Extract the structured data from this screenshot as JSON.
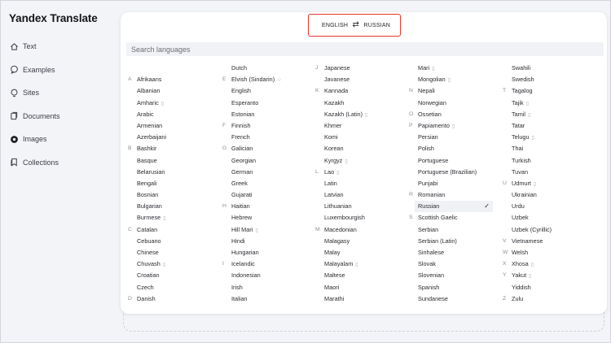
{
  "app": {
    "title": "Yandex Translate"
  },
  "nav": [
    {
      "label": "Text",
      "icon": "home-icon"
    },
    {
      "label": "Examples",
      "icon": "speech-bubble-icon"
    },
    {
      "label": "Sites",
      "icon": "lightbulb-icon"
    },
    {
      "label": "Documents",
      "icon": "document-icon"
    },
    {
      "label": "Images",
      "icon": "camera-icon"
    },
    {
      "label": "Collections",
      "icon": "bookmark-icon"
    }
  ],
  "switcher": {
    "source": "ENGLISH",
    "target": "RUSSIAN",
    "swap_icon": "swap-arrows-icon"
  },
  "search": {
    "placeholder": "Search languages"
  },
  "columns": [
    [
      {
        "name": ""
      },
      {
        "name": "Afrikaans",
        "letter": "A"
      },
      {
        "name": "Albanian"
      },
      {
        "name": "Amharic",
        "beta": true
      },
      {
        "name": "Arabic"
      },
      {
        "name": "Armenian"
      },
      {
        "name": "Azerbaijani"
      },
      {
        "name": "Bashkir",
        "letter": "B"
      },
      {
        "name": "Basque"
      },
      {
        "name": "Belarusian"
      },
      {
        "name": "Bengali"
      },
      {
        "name": "Bosnian"
      },
      {
        "name": "Bulgarian"
      },
      {
        "name": "Burmese",
        "beta": true
      },
      {
        "name": "Catalan",
        "letter": "C"
      },
      {
        "name": "Cebuano"
      },
      {
        "name": "Chinese"
      },
      {
        "name": "Chuvash",
        "beta": true
      },
      {
        "name": "Croatian"
      },
      {
        "name": "Czech"
      },
      {
        "name": "Danish",
        "letter": "D"
      }
    ],
    [
      {
        "name": "Dutch"
      },
      {
        "name": "Elvish (Sindarin)",
        "letter": "E",
        "beta": true,
        "beta_mark": "☆"
      },
      {
        "name": "English"
      },
      {
        "name": "Esperanto"
      },
      {
        "name": "Estonian"
      },
      {
        "name": "Finnish",
        "letter": "F"
      },
      {
        "name": "French"
      },
      {
        "name": "Galician",
        "letter": "G"
      },
      {
        "name": "Georgian"
      },
      {
        "name": "German"
      },
      {
        "name": "Greek"
      },
      {
        "name": "Gujarati"
      },
      {
        "name": "Haitian",
        "letter": "H"
      },
      {
        "name": "Hebrew"
      },
      {
        "name": "Hill Mari",
        "beta": true
      },
      {
        "name": "Hindi"
      },
      {
        "name": "Hungarian"
      },
      {
        "name": "Icelandic",
        "letter": "I"
      },
      {
        "name": "Indonesian"
      },
      {
        "name": "Irish"
      },
      {
        "name": "Italian"
      }
    ],
    [
      {
        "name": "Japanese",
        "letter": "J"
      },
      {
        "name": "Javanese"
      },
      {
        "name": "Kannada",
        "letter": "K"
      },
      {
        "name": "Kazakh"
      },
      {
        "name": "Kazakh (Latin)",
        "beta": true
      },
      {
        "name": "Khmer"
      },
      {
        "name": "Komi"
      },
      {
        "name": "Korean"
      },
      {
        "name": "Kyrgyz",
        "beta": true
      },
      {
        "name": "Lao",
        "letter": "L",
        "beta": true
      },
      {
        "name": "Latin"
      },
      {
        "name": "Latvian"
      },
      {
        "name": "Lithuanian"
      },
      {
        "name": "Luxembourgish"
      },
      {
        "name": "Macedonian",
        "letter": "M"
      },
      {
        "name": "Malagasy"
      },
      {
        "name": "Malay"
      },
      {
        "name": "Malayalam",
        "beta": true
      },
      {
        "name": "Maltese"
      },
      {
        "name": "Maori"
      },
      {
        "name": "Marathi"
      }
    ],
    [
      {
        "name": "Mari",
        "beta": true
      },
      {
        "name": "Mongolian",
        "beta": true
      },
      {
        "name": "Nepali",
        "letter": "N"
      },
      {
        "name": "Norwegian"
      },
      {
        "name": "Ossetian",
        "letter": "O"
      },
      {
        "name": "Papiamento",
        "letter": "P",
        "beta": true
      },
      {
        "name": "Persian"
      },
      {
        "name": "Polish"
      },
      {
        "name": "Portuguese"
      },
      {
        "name": "Portuguese (Brazilian)"
      },
      {
        "name": "Punjabi"
      },
      {
        "name": "Romanian",
        "letter": "R"
      },
      {
        "name": "Russian",
        "selected": true
      },
      {
        "name": "Scottish Gaelic",
        "letter": "S"
      },
      {
        "name": "Serbian"
      },
      {
        "name": "Serbian (Latin)"
      },
      {
        "name": "Sinhalese"
      },
      {
        "name": "Slovak"
      },
      {
        "name": "Slovenian"
      },
      {
        "name": "Spanish"
      },
      {
        "name": "Sundanese"
      }
    ],
    [
      {
        "name": "Swahili"
      },
      {
        "name": "Swedish"
      },
      {
        "name": "Tagalog",
        "letter": "T"
      },
      {
        "name": "Tajik",
        "beta": true
      },
      {
        "name": "Tamil",
        "beta": true
      },
      {
        "name": "Tatar"
      },
      {
        "name": "Telugu",
        "beta": true
      },
      {
        "name": "Thai"
      },
      {
        "name": "Turkish"
      },
      {
        "name": "Tuvan"
      },
      {
        "name": "Udmurt",
        "letter": "U",
        "beta": true
      },
      {
        "name": "Ukrainian"
      },
      {
        "name": "Urdu"
      },
      {
        "name": "Uzbek"
      },
      {
        "name": "Uzbek (Cyrillic)"
      },
      {
        "name": "Vietnamese",
        "letter": "V"
      },
      {
        "name": "Welsh",
        "letter": "W"
      },
      {
        "name": "Xhosa",
        "letter": "X",
        "beta": true
      },
      {
        "name": "Yakut",
        "letter": "Y",
        "beta": true
      },
      {
        "name": "Yiddish"
      },
      {
        "name": "Zulu",
        "letter": "Z"
      }
    ]
  ],
  "beta_glyph": "▯",
  "selected_check": "✓"
}
